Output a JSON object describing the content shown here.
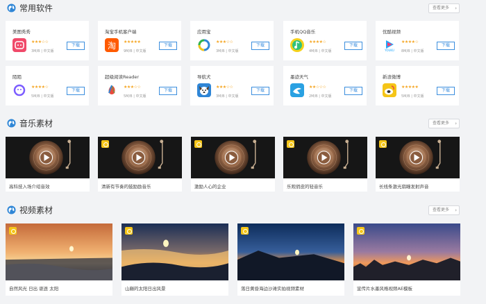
{
  "sections": {
    "apps": {
      "title": "常用软件",
      "more": "查看更多"
    },
    "music": {
      "title": "音乐素材",
      "more": "查看更多"
    },
    "video": {
      "title": "视频素材",
      "more": "查看更多"
    }
  },
  "apps": [
    {
      "name": "美图秀秀",
      "rating": 3,
      "size": "3M/B",
      "lang": "中文版",
      "download": "下载",
      "icon": "meitu-icon"
    },
    {
      "name": "淘宝手机客户端",
      "rating": 5,
      "size": "9M/B",
      "lang": "中文版",
      "download": "下载",
      "icon": "taobao-icon"
    },
    {
      "name": "应用宝",
      "rating": 3,
      "size": "3M/B",
      "lang": "中文版",
      "download": "下载",
      "icon": "yingyongbao-icon"
    },
    {
      "name": "手机QQ音乐",
      "rating": 4,
      "size": "4M/B",
      "lang": "中文版",
      "download": "下载",
      "icon": "qqmusic-icon"
    },
    {
      "name": "优酷视频",
      "rating": 4,
      "size": "8M/B",
      "lang": "中文版",
      "download": "下载",
      "icon": "youku-icon"
    },
    {
      "name": "陌陌",
      "rating": 4,
      "size": "5M/B",
      "lang": "中文版",
      "download": "下载",
      "icon": "momo-icon"
    },
    {
      "name": "超级阅读Reader",
      "rating": 3,
      "size": "5M/B",
      "lang": "中文版",
      "download": "下载",
      "icon": "reader-icon"
    },
    {
      "name": "导航犬",
      "rating": 3,
      "size": "3M/B",
      "lang": "中文版",
      "download": "下载",
      "icon": "dog-icon"
    },
    {
      "name": "墨迹天气",
      "rating": 2,
      "size": "2M/B",
      "lang": "中文版",
      "download": "下载",
      "icon": "weather-icon"
    },
    {
      "name": "新浪微博",
      "rating": 5,
      "size": "5M/B",
      "lang": "中文版",
      "download": "下载",
      "icon": "weibo-icon"
    }
  ],
  "music": [
    {
      "label": "高科技入场介绍音效",
      "premium": false
    },
    {
      "label": "清新有节奏的鼓励励音乐",
      "premium": true
    },
    {
      "label": "激励人心的企业",
      "premium": true
    },
    {
      "label": "乐观俏皮的轻音乐",
      "premium": true
    },
    {
      "label": "长线条激光扇瞳发射声音",
      "premium": true
    }
  ],
  "videos": [
    {
      "label": "自然风光 日出 驱逐 太阳",
      "premium": true
    },
    {
      "label": "山巅的太阳日出风景",
      "premium": true
    },
    {
      "label": "落日黄昏海边沙滩实拍视频素材",
      "premium": true
    },
    {
      "label": "宣传片水墨风格视频AE模板",
      "premium": true
    }
  ],
  "colors": {
    "accent": "#3b8ede",
    "star": "#f5a623",
    "badge": "#f5c518"
  }
}
